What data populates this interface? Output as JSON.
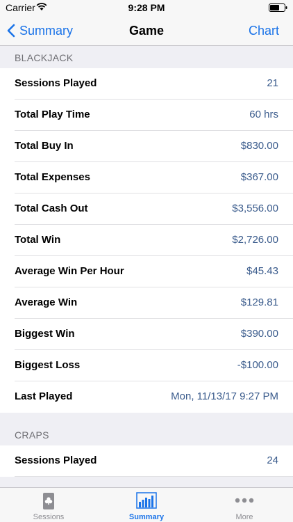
{
  "status": {
    "carrier": "Carrier",
    "time": "9:28 PM"
  },
  "nav": {
    "back_label": "Summary",
    "title": "Game",
    "action_label": "Chart"
  },
  "sections": [
    {
      "header": "BLACKJACK",
      "rows": [
        {
          "label": "Sessions Played",
          "value": "21"
        },
        {
          "label": "Total Play Time",
          "value": "60 hrs"
        },
        {
          "label": "Total Buy In",
          "value": "$830.00"
        },
        {
          "label": "Total Expenses",
          "value": "$367.00"
        },
        {
          "label": "Total Cash Out",
          "value": "$3,556.00"
        },
        {
          "label": "Total Win",
          "value": "$2,726.00"
        },
        {
          "label": "Average Win Per Hour",
          "value": "$45.43"
        },
        {
          "label": "Average Win",
          "value": "$129.81"
        },
        {
          "label": "Biggest Win",
          "value": "$390.00"
        },
        {
          "label": "Biggest Loss",
          "value": "-$100.00"
        },
        {
          "label": "Last Played",
          "value": "Mon, 11/13/17 9:27 PM"
        }
      ]
    },
    {
      "header": "CRAPS",
      "rows": [
        {
          "label": "Sessions Played",
          "value": "24"
        }
      ]
    }
  ],
  "tabs": [
    {
      "label": "Sessions",
      "icon": "card-club-icon",
      "active": false
    },
    {
      "label": "Summary",
      "icon": "bar-chart-icon",
      "active": true
    },
    {
      "label": "More",
      "icon": "more-dots-icon",
      "active": false
    }
  ],
  "colors": {
    "accent": "#1a73e8",
    "value_text": "#3a5b8c",
    "background": "#efeff4"
  }
}
